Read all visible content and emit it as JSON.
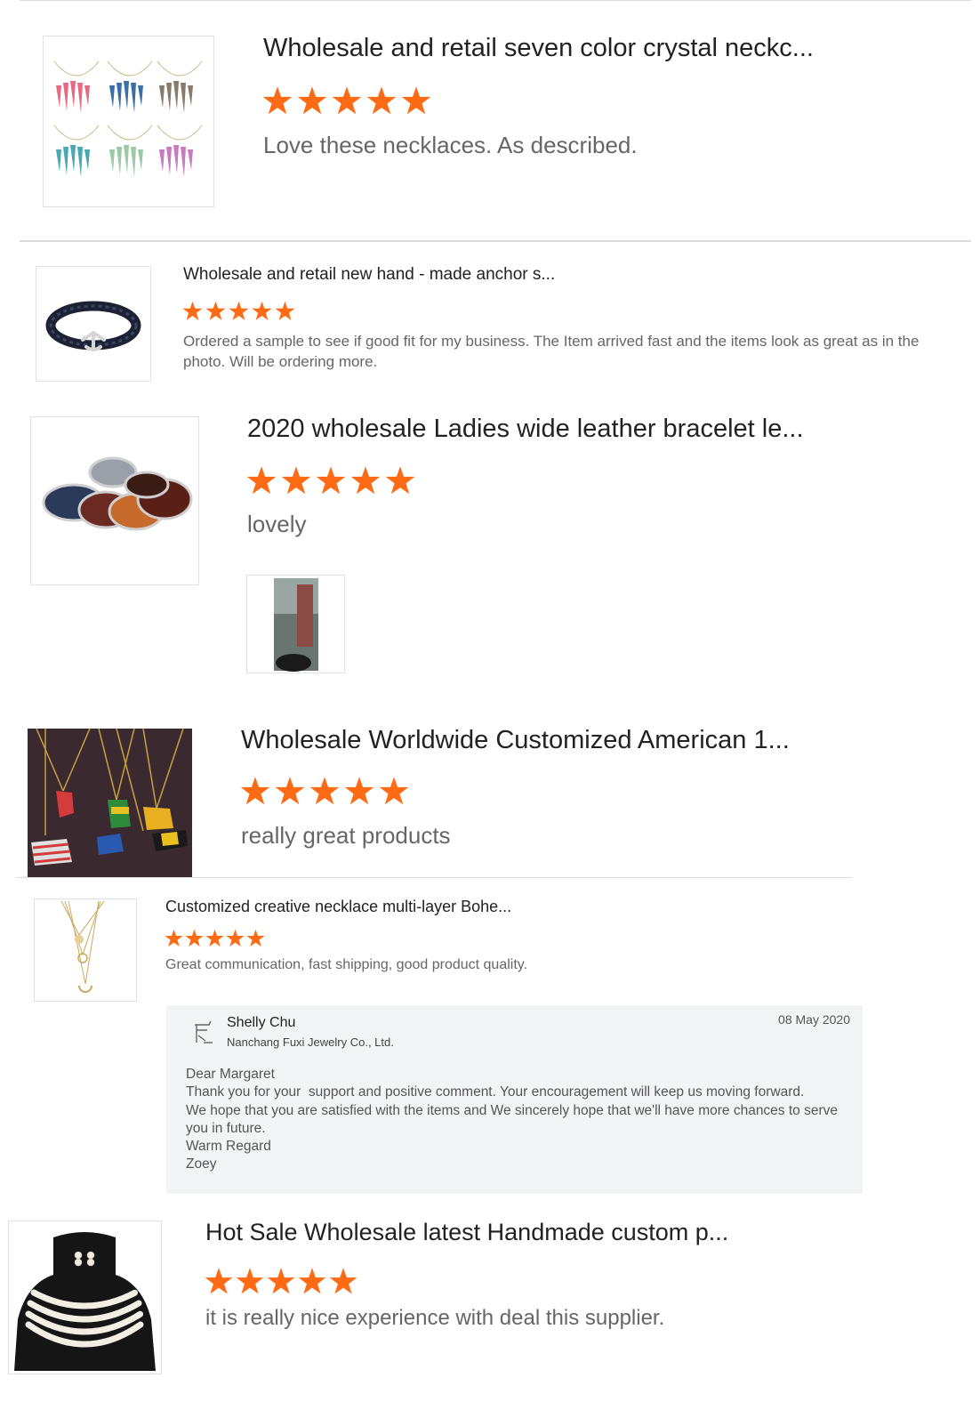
{
  "colors": {
    "star": "#ff6a14",
    "rule": "#dcdcdc",
    "reply_bg": "#f3f4f6"
  },
  "reviews": [
    {
      "title": "Wholesale and retail seven color crystal neckc...",
      "rating": 5,
      "comment": "Love these necklaces. As described.",
      "image": "crystal-necklaces-image"
    },
    {
      "title": "Wholesale and retail new hand - made anchor s...",
      "rating": 5,
      "comment": "Ordered a sample to see if good fit for my business. The Item arrived fast and the items look as great as in the photo. Will be ordering more.",
      "image": "anchor-bracelet-image"
    },
    {
      "title": "2020 wholesale Ladies wide leather bracelet le...",
      "rating": 5,
      "comment": "lovely",
      "image": "leather-bracelets-image",
      "attachment": "buyer-photo-image"
    },
    {
      "title": "Wholesale Worldwide Customized American 1...",
      "rating": 5,
      "comment": "really great products",
      "image": "map-pendant-necklaces-image"
    },
    {
      "title": "Customized creative necklace multi-layer Bohe...",
      "rating": 5,
      "comment": "Great communication, fast shipping, good product quality.",
      "image": "layered-necklace-image",
      "reply": {
        "author": "Shelly Chu",
        "company": "Nanchang Fuxi Jewelry Co., Ltd.",
        "date": "08 May 2020",
        "avatar_icon": "user-avatar-icon",
        "lines": [
          "Dear Margaret",
          "Thank you for your  support and positive comment. Your encouragement will keep us moving forward.",
          "We hope that you are satisfied with the items and We sincerely hope that we'll have more chances to serve",
          "you in future.",
          "Warm Regard",
          "Zoey"
        ]
      }
    },
    {
      "title": "Hot Sale Wholesale latest Handmade custom p...",
      "rating": 5,
      "comment": "it is really nice experience with deal this supplier.",
      "image": "pearl-necklace-image"
    }
  ]
}
